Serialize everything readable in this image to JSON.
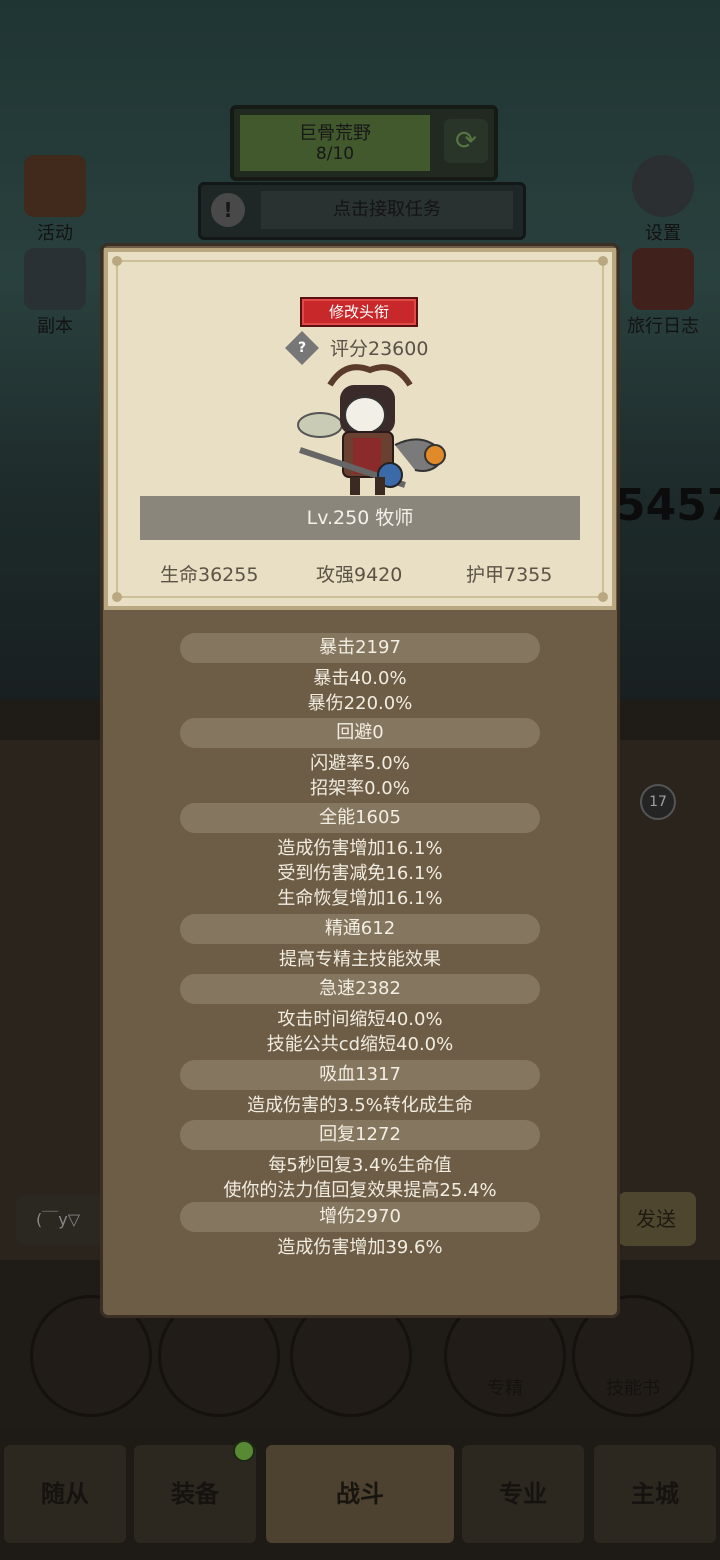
{
  "background": {
    "area": {
      "name": "巨骨荒野",
      "progress": "8/10"
    },
    "quest_button": "点击接取任务",
    "left_buttons": [
      "活动",
      "副本"
    ],
    "right_buttons": [
      "设置",
      "旅行日志"
    ],
    "score_partial": "5457",
    "chat_placeholder": "(￣y▽",
    "send_label": "发送",
    "quick_buttons": [
      "专精",
      "技能书"
    ],
    "nav_tabs": [
      "随从",
      "装备",
      "战斗",
      "专业",
      "主城"
    ],
    "badge": "17"
  },
  "card": {
    "edit_title_button": "修改头衔",
    "help_icon_glyph": "?",
    "score": "评分23600",
    "level_class": "Lv.250 牧师",
    "stats": {
      "hp": "生命36255",
      "atk": "攻强9420",
      "armor": "护甲7355"
    }
  },
  "sections": [
    {
      "head": "暴击2197",
      "lines": [
        "暴击40.0%",
        "暴伤220.0%"
      ]
    },
    {
      "head": "回避0",
      "lines": [
        "闪避率5.0%",
        "招架率0.0%"
      ]
    },
    {
      "head": "全能1605",
      "lines": [
        "造成伤害增加16.1%",
        "受到伤害减免16.1%",
        "生命恢复增加16.1%"
      ]
    },
    {
      "head": "精通612",
      "lines": [
        "提高专精主技能效果"
      ]
    },
    {
      "head": "急速2382",
      "lines": [
        "攻击时间缩短40.0%",
        "技能公共cd缩短40.0%"
      ]
    },
    {
      "head": "吸血1317",
      "lines": [
        "造成伤害的3.5%转化成生命"
      ]
    },
    {
      "head": "回复1272",
      "lines": [
        "每5秒回复3.4%生命值",
        "使你的法力值回复效果提高25.4%"
      ]
    },
    {
      "head": "增伤2970",
      "lines": [
        "造成伤害增加39.6%"
      ]
    }
  ],
  "colors": {
    "popup": "#6e5d46",
    "card": "#e9dfc4",
    "title_button": "#c8282a"
  }
}
